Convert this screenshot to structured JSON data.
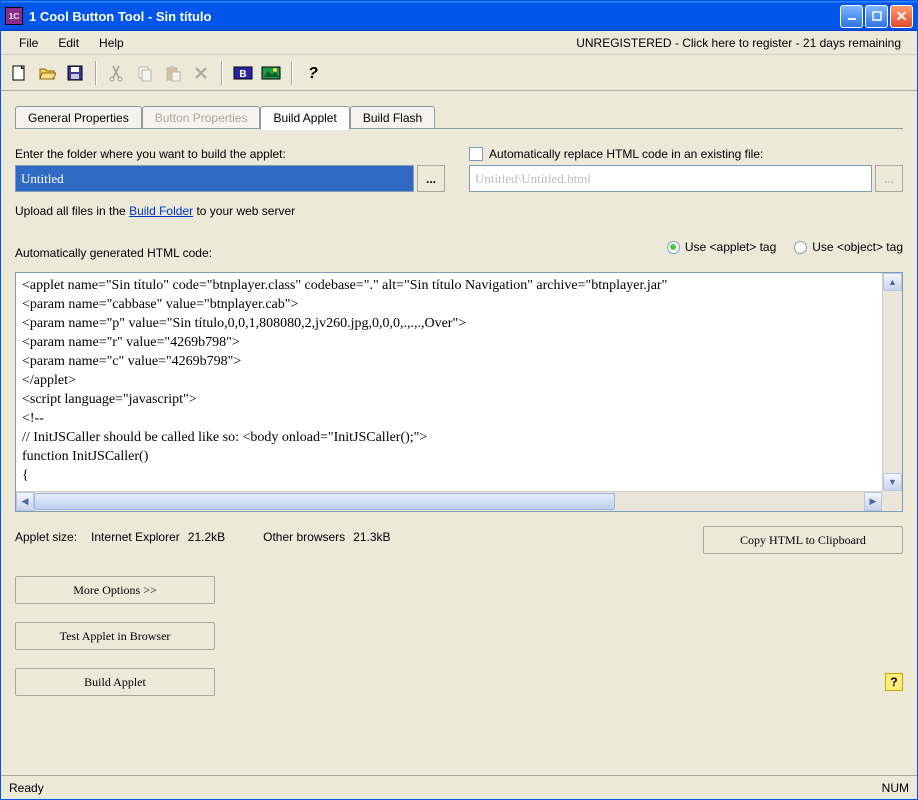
{
  "title": "1 Cool Button Tool - Sin título",
  "menu": {
    "file": "File",
    "edit": "Edit",
    "help": "Help"
  },
  "reg_notice": "UNREGISTERED - Click here to register - 21 days remaining",
  "tabs": {
    "general": "General Properties",
    "button": "Button Properties",
    "build_applet": "Build Applet",
    "build_flash": "Build Flash"
  },
  "folder_label": "Enter the folder where you want to build the applet:",
  "folder_value": "Untitled",
  "auto_replace_label": "Automatically replace HTML code in an existing file:",
  "auto_replace_value": "Untitled\\Untitled.html",
  "upload_prefix": "Upload all files in the ",
  "upload_link": "Build Folder",
  "upload_suffix": " to your web server",
  "code_label": "Automatically generated HTML code:",
  "radio_applet": "Use <applet> tag",
  "radio_object": "Use <object> tag",
  "code": "<applet name=\"Sin título\" code=\"btnplayer.class\" codebase=\".\" alt=\"Sin título Navigation\" archive=\"btnplayer.jar\" \n<param name=\"cabbase\" value=\"btnplayer.cab\">\n<param name=\"p\" value=\"Sin título,0,0,1,808080,2,jv260.jpg,0,0,0,.,.,.,Over\">\n<param name=\"r\" value=\"4269b798\">\n<param name=\"c\" value=\"4269b798\">\n</applet>\n<script language=\"javascript\">\n<!--\n// InitJSCaller should be called like so: <body onload=\"InitJSCaller();\">\nfunction InitJSCaller()\n{",
  "size_label": "Applet size:",
  "size_ie_label": "Internet Explorer",
  "size_ie_val": "21.2kB",
  "size_other_label": "Other browsers",
  "size_other_val": "21.3kB",
  "btn_copy": "Copy HTML to Clipboard",
  "btn_more": "More Options >>",
  "btn_test": "Test Applet in Browser",
  "btn_build": "Build Applet",
  "status_ready": "Ready",
  "status_num": "NUM",
  "browse_dots": "..."
}
